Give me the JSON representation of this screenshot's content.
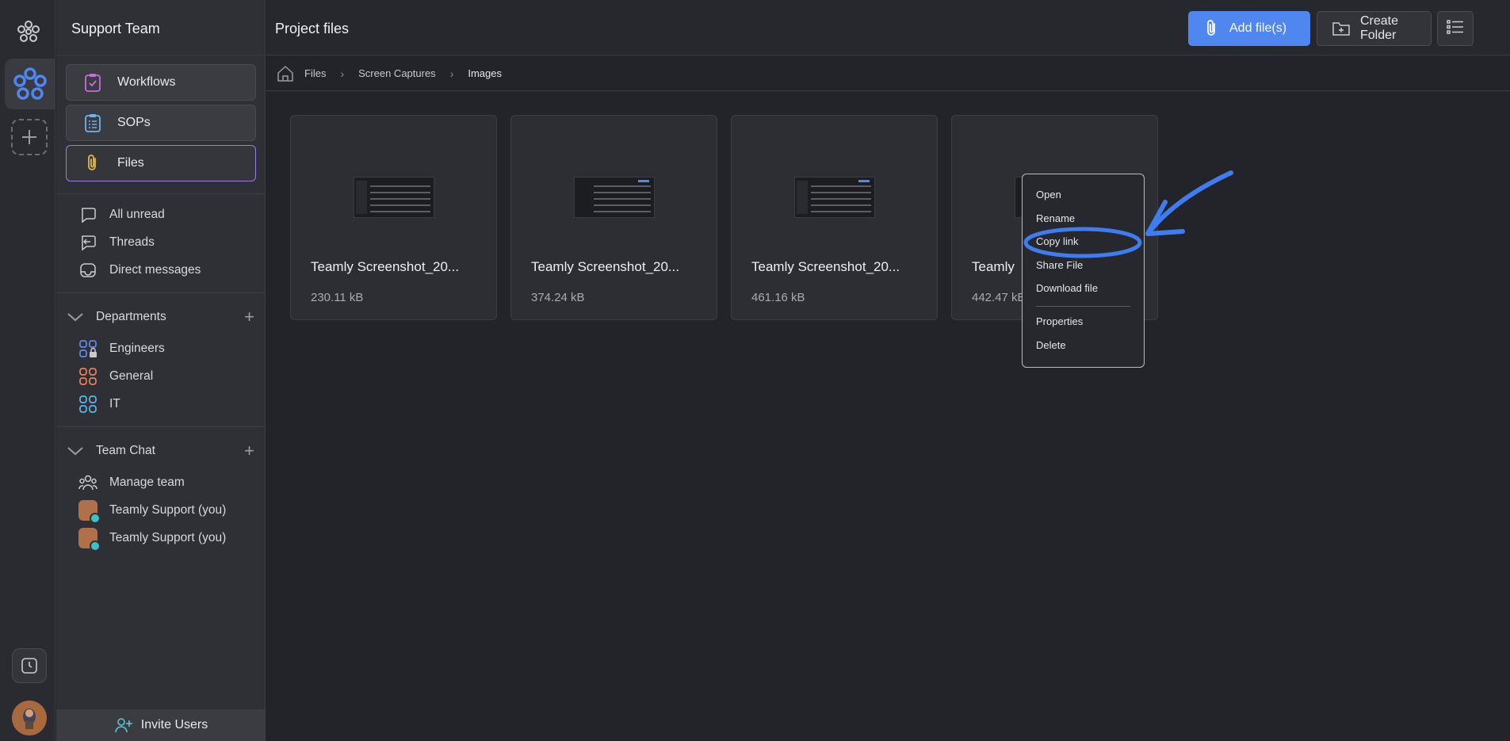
{
  "sidebar": {
    "team_name": "Support Team",
    "cards": [
      {
        "label": "Workflows",
        "icon": "clipboard-check-icon"
      },
      {
        "label": "SOPs",
        "icon": "list-clipboard-icon"
      },
      {
        "label": "Files",
        "icon": "paperclip-icon"
      }
    ],
    "quick": [
      {
        "label": "All unread",
        "icon": "chat-bubble-icon"
      },
      {
        "label": "Threads",
        "icon": "threads-icon"
      },
      {
        "label": "Direct messages",
        "icon": "inbox-icon"
      }
    ],
    "departments": {
      "title": "Departments",
      "items": [
        {
          "label": "Engineers",
          "icon": "locked-grid-icon",
          "color": "#5b8cf0"
        },
        {
          "label": "General",
          "icon": "grid-icon",
          "color": "#e8835a"
        },
        {
          "label": "IT",
          "icon": "grid-icon",
          "color": "#5bb8e8"
        }
      ]
    },
    "team_chat": {
      "title": "Team Chat",
      "items": [
        {
          "label": "Manage team",
          "icon": "team-icon"
        },
        {
          "label": "Teamly Support (you)",
          "icon": "avatar"
        },
        {
          "label": "Teamly Support (you)",
          "icon": "avatar"
        }
      ]
    },
    "invite_label": "Invite Users"
  },
  "header": {
    "title": "Project files",
    "add_files_label": "Add file(s)",
    "create_folder_label": "Create Folder"
  },
  "breadcrumb": [
    "Files",
    "Screen Captures",
    "Images"
  ],
  "files": [
    {
      "name": "Teamly Screenshot_20...",
      "size": "230.11 kB"
    },
    {
      "name": "Teamly Screenshot_20...",
      "size": "374.24 kB"
    },
    {
      "name": "Teamly Screenshot_20...",
      "size": "461.16 kB"
    },
    {
      "name": "Teamly",
      "size": "442.47 kB"
    }
  ],
  "context_menu": [
    "Open",
    "Rename",
    "Copy link",
    "Share File",
    "Download file",
    "Properties",
    "Delete"
  ],
  "colors": {
    "accent": "#4f86f0",
    "active_border": "#9b7ee8",
    "annotation": "#3f7cf0"
  }
}
